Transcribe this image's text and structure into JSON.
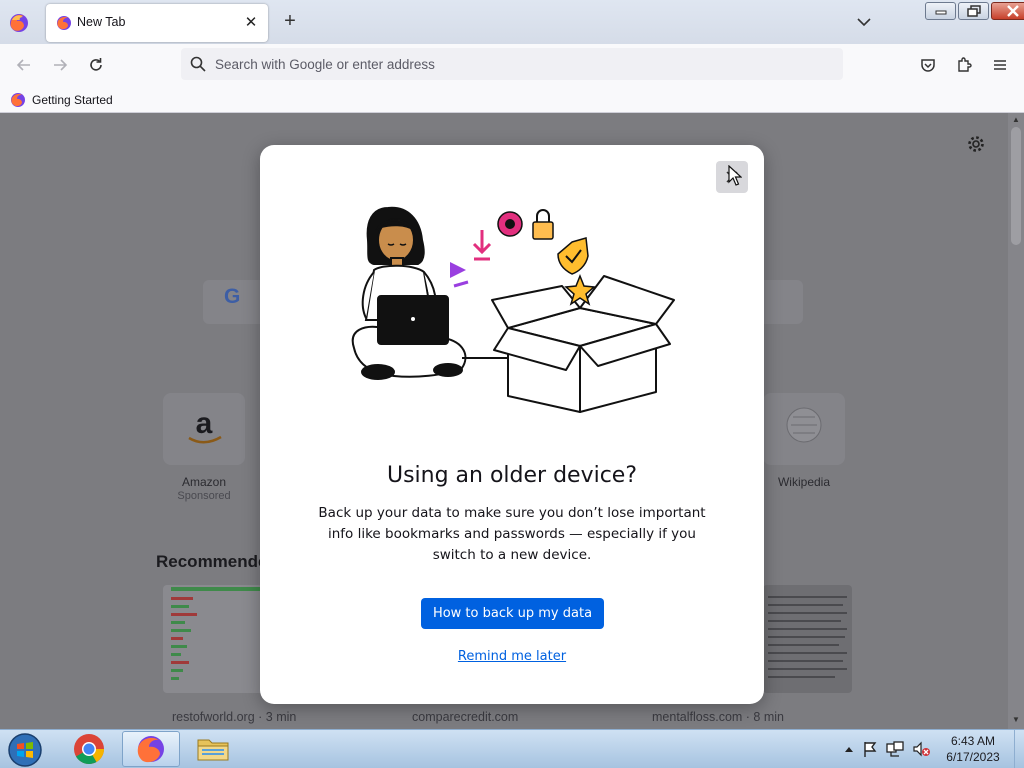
{
  "browser": {
    "tab_title": "New Tab",
    "new_tab_symbol": "+",
    "tab_close_symbol": "✕",
    "url_placeholder": "Search with Google or enter address",
    "bookmark": "Getting Started"
  },
  "newtab_page": {
    "shortcuts": [
      {
        "label": "Amazon",
        "sublabel": "Sponsored"
      },
      {
        "label": "Wikipedia",
        "sublabel": ""
      }
    ],
    "recommended_heading": "Recommende",
    "cards": [
      {
        "meta": "restofworld.org · 3 min"
      },
      {
        "meta": "comparecredit.com"
      },
      {
        "meta": "mentalfloss.com · 8 min"
      }
    ]
  },
  "modal": {
    "title": "Using an older device?",
    "body": "Back up your data to make sure you don’t lose important info like bookmarks and passwords — especially if you switch to a new device.",
    "primary_button": "How to back up my data",
    "secondary_link": "Remind me later"
  },
  "taskbar": {
    "time": "6:43 AM",
    "date": "6/17/2023"
  },
  "colors": {
    "accent": "#0061e0",
    "overlay": "#7c7c80",
    "taskbar": "#a6c3e0"
  }
}
